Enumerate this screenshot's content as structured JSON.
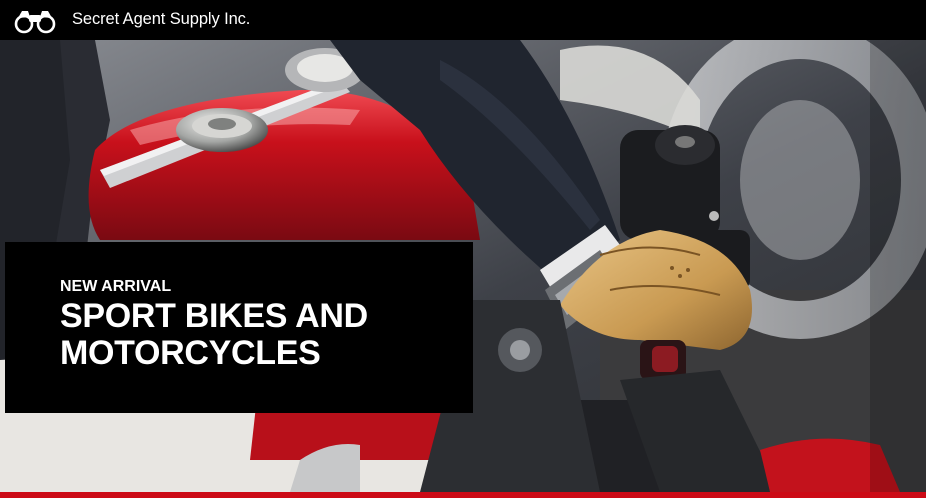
{
  "header": {
    "brand_name": "Secret Agent Supply Inc.",
    "logo_icon": "binoculars-icon"
  },
  "hero": {
    "eyebrow": "NEW ARRIVAL",
    "headline_line1": "SPORT BIKES AND",
    "headline_line2": "MOTORCYCLES",
    "image_subject": "hero-image"
  },
  "colors": {
    "header_bg": "#000000",
    "promo_bg": "#000000",
    "accent": "#cc0a16",
    "text": "#ffffff"
  }
}
